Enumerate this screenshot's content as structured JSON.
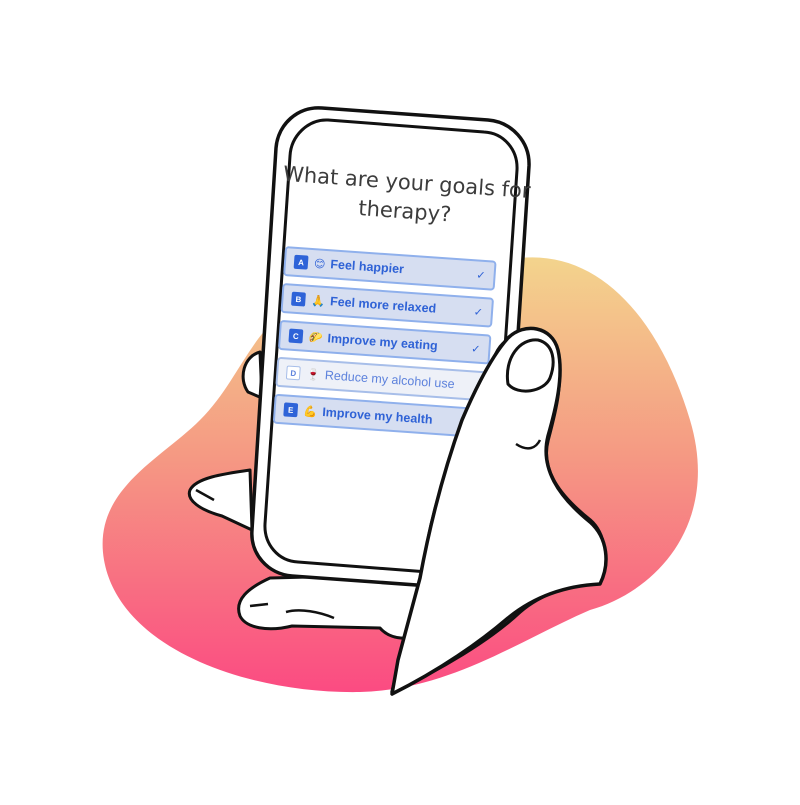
{
  "screen": {
    "question": "What are your goals for therapy?",
    "options": [
      {
        "key": "A",
        "icon": "smiling-face-icon",
        "emoji": "😊",
        "label": "Feel happier",
        "selected": true
      },
      {
        "key": "B",
        "icon": "folded-hands-icon",
        "emoji": "🙏",
        "label": "Feel more relaxed",
        "selected": true
      },
      {
        "key": "C",
        "icon": "taco-icon",
        "emoji": "🌮",
        "label": "Improve my eating",
        "selected": true
      },
      {
        "key": "D",
        "icon": "wine-glass-icon",
        "emoji": "🍷",
        "label": "Reduce my alcohol use",
        "selected": false
      },
      {
        "key": "E",
        "icon": "flexed-biceps-icon",
        "emoji": "💪",
        "label": "Improve my health",
        "selected": true
      }
    ],
    "check_mark": "✓"
  },
  "colors": {
    "accent": "#2e63d8",
    "selected_bg": "#d6def1",
    "blob_top": "#f3cf8c",
    "blob_bottom": "#fa4e82"
  }
}
